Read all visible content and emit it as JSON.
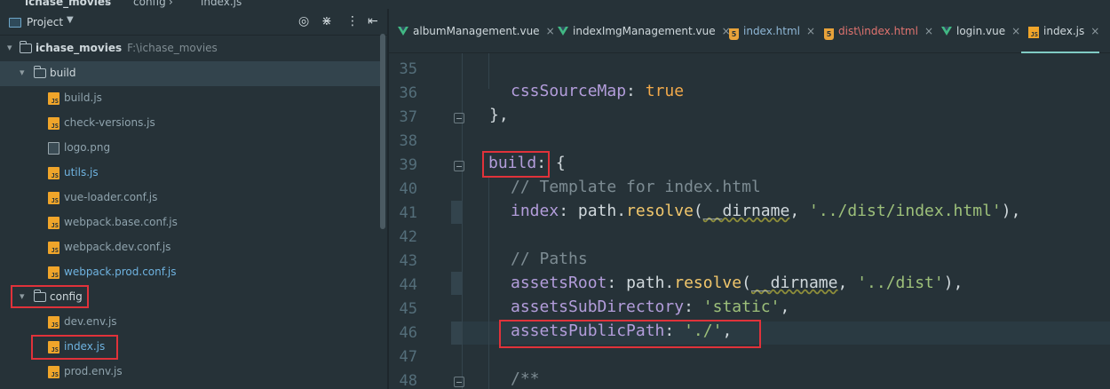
{
  "breadcrumb": {
    "root": "ichase_movies",
    "folder": "config",
    "file": "index.js"
  },
  "project_panel": {
    "title": "Project",
    "tree": [
      {
        "label": "ichase_movies",
        "path": "F:\\ichase_movies",
        "kind": "root"
      },
      {
        "label": "build",
        "kind": "folder",
        "selected": true
      },
      {
        "label": "build.js",
        "kind": "js"
      },
      {
        "label": "check-versions.js",
        "kind": "js"
      },
      {
        "label": "logo.png",
        "kind": "png"
      },
      {
        "label": "utils.js",
        "kind": "js"
      },
      {
        "label": "vue-loader.conf.js",
        "kind": "js"
      },
      {
        "label": "webpack.base.conf.js",
        "kind": "js"
      },
      {
        "label": "webpack.dev.conf.js",
        "kind": "js"
      },
      {
        "label": "webpack.prod.conf.js",
        "kind": "js"
      },
      {
        "label": "config",
        "kind": "folder"
      },
      {
        "label": "dev.env.js",
        "kind": "js"
      },
      {
        "label": "index.js",
        "kind": "js"
      },
      {
        "label": "prod.env.js",
        "kind": "js"
      }
    ]
  },
  "tabs": [
    {
      "label": "albumManagement.vue",
      "icon": "vue-icon"
    },
    {
      "label": "indexImgManagement.vue",
      "icon": "vue-icon"
    },
    {
      "label": "index.html",
      "icon": "html-icon"
    },
    {
      "label": "dist\\index.html",
      "icon": "html-icon"
    },
    {
      "label": "login.vue",
      "icon": "vue-icon"
    },
    {
      "label": "index.js",
      "icon": "js-icon",
      "active": true
    }
  ],
  "editor": {
    "line_numbers": [
      "35",
      "36",
      "37",
      "38",
      "39",
      "40",
      "41",
      "42",
      "43",
      "44",
      "45",
      "46",
      "47",
      "48"
    ],
    "lines": {
      "l36": {
        "prop": "cssSourceMap",
        "colon": ": ",
        "val": "true"
      },
      "l37": {
        "text": "},"
      },
      "l39": {
        "prop": "build",
        "colon": ":",
        "brace": " {"
      },
      "l40": {
        "comment": "// Template for index.html"
      },
      "l41": {
        "prop": "index",
        "colon": ": ",
        "obj": "path.",
        "fn": "resolve",
        "open": "(",
        "dirname": "__dirname",
        "sep": ", ",
        "str": "'../dist/index.html'",
        "close": "),"
      },
      "l43": {
        "comment": "// Paths"
      },
      "l44": {
        "prop": "assetsRoot",
        "colon": ": ",
        "obj": "path.",
        "fn": "resolve",
        "open": "(",
        "dirname": "__dirname",
        "sep": ", ",
        "str": "'../dist'",
        "close": "),"
      },
      "l45": {
        "prop": "assetsSubDirectory",
        "colon": ": ",
        "str": "'static'",
        "close": ","
      },
      "l46": {
        "prop": "assetsPublicPath",
        "colon": ": ",
        "str": "'./'",
        "close": ","
      },
      "l48": {
        "comment": "/**"
      }
    }
  },
  "colors": {
    "background": "#263238",
    "annotation": "#e0323a",
    "active_tab_underline": "#80cbc4"
  }
}
